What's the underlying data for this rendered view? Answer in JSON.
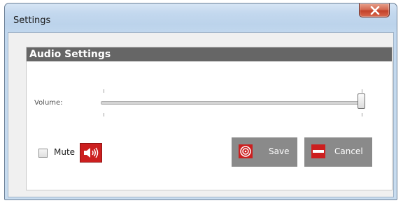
{
  "window": {
    "title": "Settings"
  },
  "panel": {
    "header": "Audio Settings"
  },
  "volume": {
    "label": "Volume:",
    "level_percent": 100
  },
  "mute": {
    "label": "Mute",
    "checked": false
  },
  "buttons": {
    "save_label": "Save",
    "cancel_label": "Cancel"
  },
  "icons": {
    "close": "close-icon",
    "speaker": "speaker-icon",
    "save": "target-icon",
    "cancel": "minus-icon"
  },
  "colors": {
    "accent_red": "#cc1f1f",
    "header_gray": "#666666",
    "button_gray": "#8a8a8a"
  }
}
